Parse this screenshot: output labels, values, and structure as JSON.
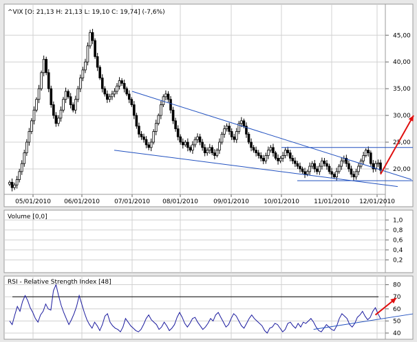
{
  "colors": {
    "background": "#e8e8e8",
    "panel": "#ffffff",
    "grid": "#d0d0d0",
    "candle": "#000000",
    "trendline": "#1f4fbf",
    "rsi_line": "#1a1a9e",
    "annotation_arrow": "#e01010"
  },
  "chart_data": [
    {
      "type": "candlestick",
      "title": "^VIX [O: 21,13  H: 21,13  L: 19,10  C: 19,74] (-7,6%)",
      "x_tick_labels": [
        "05/01/2010",
        "06/01/2010",
        "07/01/2010",
        "08/01/2010",
        "09/01/2010",
        "10/01/2010",
        "11/01/2010",
        "12/01/2010"
      ],
      "y_tick_labels": [
        "20,00",
        "25,00",
        "30,00",
        "35,00",
        "40,00",
        "45,00"
      ],
      "y_ticks": [
        20,
        25,
        30,
        35,
        40,
        45
      ],
      "ylim": [
        15.5,
        48.5
      ],
      "grid": true,
      "close_series_approx": [
        17.5,
        16.5,
        17.0,
        18.0,
        19.5,
        21.0,
        23.0,
        25.0,
        27.0,
        29.0,
        31.0,
        33.0,
        35.0,
        38.0,
        40.5,
        38.0,
        35.0,
        32.0,
        30.0,
        28.5,
        29.5,
        31.0,
        33.0,
        34.5,
        33.5,
        32.0,
        31.0,
        33.0,
        35.0,
        37.0,
        38.5,
        40.0,
        43.0,
        45.5,
        44.0,
        41.0,
        39.0,
        37.0,
        35.0,
        34.0,
        33.0,
        33.5,
        34.0,
        34.5,
        35.5,
        36.5,
        36.0,
        35.0,
        34.0,
        33.0,
        32.0,
        30.0,
        28.0,
        26.5,
        26.0,
        25.5,
        24.5,
        24.0,
        25.0,
        27.0,
        28.5,
        30.0,
        32.0,
        33.5,
        34.0,
        33.0,
        31.0,
        29.0,
        27.5,
        26.0,
        25.0,
        24.5,
        25.0,
        24.0,
        23.5,
        24.5,
        25.5,
        26.0,
        25.0,
        24.0,
        23.0,
        23.5,
        24.0,
        23.0,
        22.5,
        23.5,
        25.0,
        26.5,
        27.5,
        28.0,
        27.0,
        26.0,
        25.5,
        27.0,
        28.5,
        29.0,
        28.0,
        26.5,
        25.0,
        24.0,
        23.5,
        23.0,
        22.5,
        22.0,
        21.5,
        22.5,
        23.5,
        24.0,
        23.0,
        22.0,
        21.5,
        22.0,
        22.5,
        23.5,
        23.0,
        22.0,
        21.5,
        21.0,
        20.5,
        20.0,
        19.5,
        19.0,
        19.5,
        20.5,
        21.0,
        20.0,
        19.5,
        20.5,
        21.5,
        21.0,
        20.5,
        19.5,
        19.0,
        18.5,
        19.5,
        20.5,
        21.5,
        22.0,
        21.0,
        20.0,
        19.0,
        18.5,
        19.5,
        20.5,
        21.5,
        22.5,
        23.5,
        23.0,
        21.0,
        20.0,
        21.0,
        21.13,
        19.74
      ],
      "annotations": {
        "trendlines": [
          {
            "from": [
              "07/01/2010",
              34.5
            ],
            "to": [
              "12/01/2010",
              18.0
            ]
          },
          {
            "from": [
              "07/01/2010",
              23.5
            ],
            "to": [
              "12/01/2010",
              16.7
            ]
          },
          {
            "from": [
              "10/01/2010",
              24.0
            ],
            "to": [
              "12/01/2010",
              24.0
            ]
          },
          {
            "from": [
              "11/01/2010",
              17.8
            ],
            "to": [
              "12/01/2010",
              17.8
            ]
          }
        ],
        "arrow": {
          "from": [
            "12/01/2010",
            19.0
          ],
          "to": [
            "12/01/2010",
            30.0
          ]
        }
      }
    },
    {
      "type": "bar",
      "title": "Volume [0,0]",
      "y_tick_labels": [
        "0,2",
        "0,4",
        "0,6",
        "0,8",
        "1,0"
      ],
      "y_ticks": [
        0.2,
        0.4,
        0.6,
        0.8,
        1.0
      ],
      "ylim": [
        0.0,
        1.1
      ],
      "values": [],
      "grid": true
    },
    {
      "type": "line",
      "title": "RSI - Relative Strength Index [48]",
      "y_tick_labels": [
        "40",
        "50",
        "60",
        "70",
        "80"
      ],
      "y_ticks": [
        40,
        50,
        60,
        70,
        80
      ],
      "ylim": [
        36,
        86
      ],
      "reference_line": 70,
      "grid": true,
      "values_approx": [
        50,
        47,
        55,
        62,
        58,
        66,
        71,
        67,
        61,
        57,
        52,
        49,
        55,
        58,
        64,
        60,
        59,
        75,
        80,
        71,
        63,
        57,
        52,
        47,
        51,
        56,
        62,
        71,
        64,
        57,
        51,
        47,
        44,
        49,
        46,
        42,
        47,
        54,
        56,
        49,
        46,
        44,
        43,
        41,
        45,
        52,
        49,
        46,
        44,
        42,
        41,
        43,
        47,
        52,
        55,
        51,
        49,
        47,
        43,
        45,
        49,
        46,
        42,
        44,
        47,
        53,
        57,
        53,
        48,
        45,
        48,
        52,
        53,
        49,
        46,
        43,
        45,
        48,
        52,
        50,
        55,
        57,
        53,
        49,
        45,
        47,
        52,
        56,
        54,
        50,
        46,
        44,
        48,
        52,
        55,
        52,
        50,
        48,
        46,
        42,
        40,
        44,
        45,
        48,
        47,
        44,
        41,
        43,
        48,
        49,
        46,
        44,
        48,
        45,
        49,
        48,
        50,
        52,
        49,
        45,
        42,
        41,
        44,
        47,
        45,
        43,
        42,
        46,
        52,
        56,
        54,
        52,
        47,
        45,
        48,
        53,
        55,
        58,
        54,
        51,
        53,
        58,
        61,
        56,
        52
      ],
      "annotations": {
        "trendlines": [
          {
            "from_index": 118,
            "from_value": 43,
            "to_index": 148,
            "to_value": 53
          }
        ],
        "arrow": {
          "from_index": 142,
          "from_value": 55,
          "to_index": 149,
          "to_value": 69
        }
      }
    }
  ]
}
